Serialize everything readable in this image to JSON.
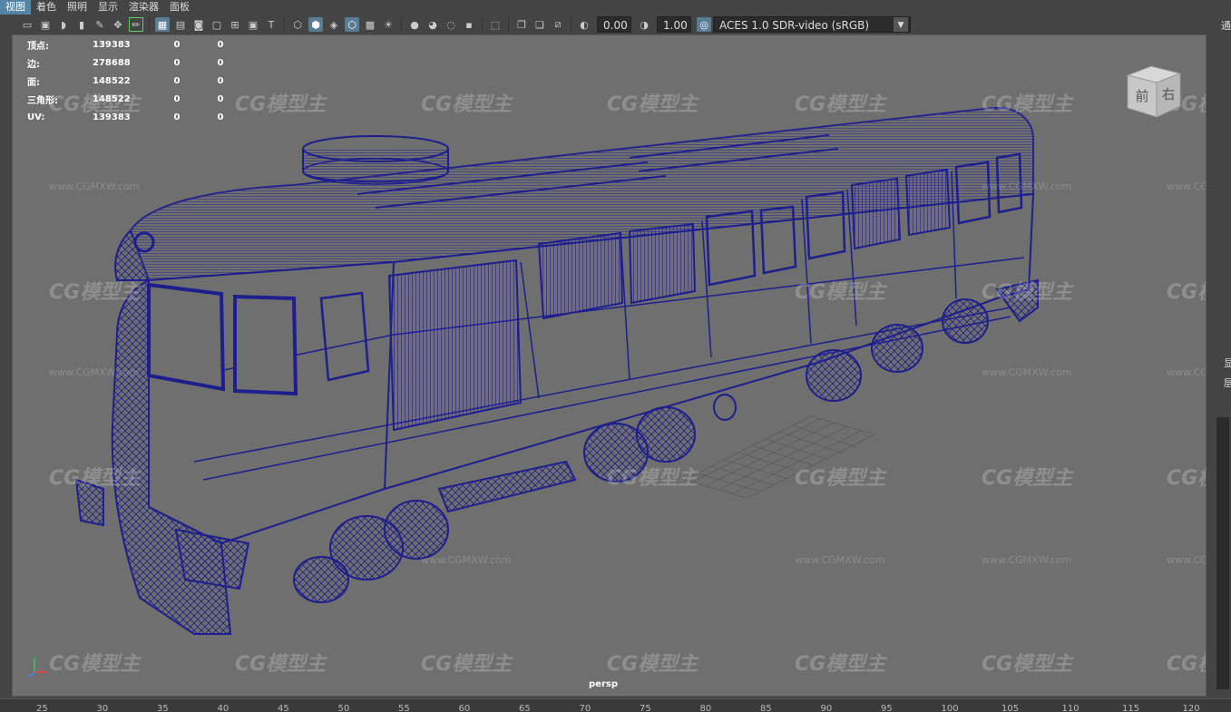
{
  "menu": [
    "视图",
    "着色",
    "照明",
    "显示",
    "渲染器",
    "面板"
  ],
  "toolbar": {
    "exposure": "0.00",
    "gamma": "1.00",
    "colorspace": "ACES 1.0 SDR-video (sRGB)"
  },
  "hud": [
    {
      "label": "顶点:",
      "v1": "139383",
      "v2": "0",
      "v3": "0"
    },
    {
      "label": "边:",
      "v1": "278688",
      "v2": "0",
      "v3": "0"
    },
    {
      "label": "面:",
      "v1": "148522",
      "v2": "0",
      "v3": "0"
    },
    {
      "label": "三角形:",
      "v1": "148522",
      "v2": "0",
      "v3": "0"
    },
    {
      "label": "UV:",
      "v1": "139383",
      "v2": "0",
      "v3": "0"
    }
  ],
  "camera": "persp",
  "viewcube": {
    "front": "前",
    "right": "右"
  },
  "watermark": "CG模型主",
  "watermark_url": "www.CGMXW.com",
  "right_panel": {
    "top": "通",
    "side1": "显",
    "side2": "层"
  },
  "ruler": [
    "25",
    "30",
    "35",
    "40",
    "45",
    "50",
    "55",
    "60",
    "65",
    "70",
    "75",
    "80",
    "85",
    "90",
    "95",
    "100",
    "105",
    "110",
    "115",
    "120"
  ],
  "colors": {
    "wireframe": "#1e1e8c",
    "viewport_bg": "#6f6f6f",
    "menu_active": "#5285a6"
  }
}
